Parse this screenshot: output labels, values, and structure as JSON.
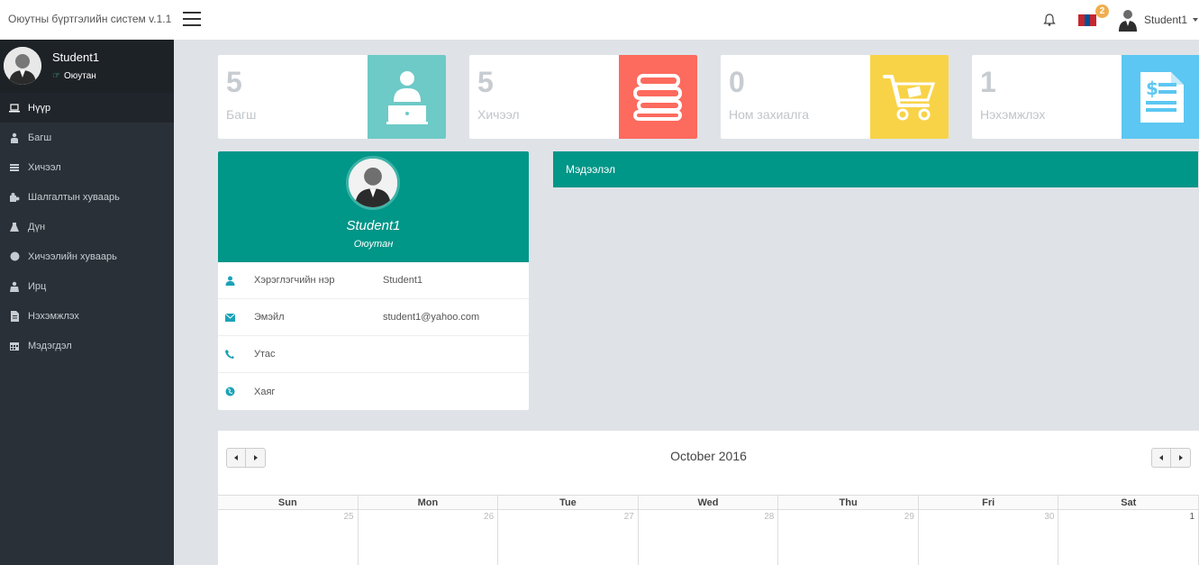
{
  "app": {
    "title": "Оюутны бүртгэлийн систем v.1.1"
  },
  "topbar": {
    "notifications_icon": "bell-icon",
    "language_badge": "2",
    "flag_colors": [
      "#c4272f",
      "#015197",
      "#c4272f"
    ],
    "user_name": "Student1"
  },
  "sidebar": {
    "user": {
      "name": "Student1",
      "role": "Оюутан",
      "status_color": "#4fd1a7"
    },
    "items": [
      {
        "label": "Нүүр",
        "icon": "laptop-icon",
        "active": true
      },
      {
        "label": "Багш",
        "icon": "teacher-icon"
      },
      {
        "label": "Хичээл",
        "icon": "book-icon"
      },
      {
        "label": "Шалгалтын хуваарь",
        "icon": "puzzle-icon"
      },
      {
        "label": "Дүн",
        "icon": "flask-icon"
      },
      {
        "label": "Хичээлийн хуваарь",
        "icon": "circle-icon"
      },
      {
        "label": "Ирц",
        "icon": "attendance-icon"
      },
      {
        "label": "Нэхэмжлэх",
        "icon": "document-icon"
      },
      {
        "label": "Мэдэгдэл",
        "icon": "calendar-icon"
      }
    ]
  },
  "stats": [
    {
      "value": "5",
      "label": "Багш",
      "color": "#6dcac7",
      "icon": "teacher-icon"
    },
    {
      "value": "5",
      "label": "Хичээл",
      "color": "#fd6a5e",
      "icon": "books-icon"
    },
    {
      "value": "0",
      "label": "Ном захиалга",
      "color": "#f8d348",
      "icon": "cart-icon"
    },
    {
      "value": "1",
      "label": "Нэхэмжлэх",
      "color": "#5cc7f2",
      "icon": "invoice-icon"
    }
  ],
  "profile": {
    "name": "Student1",
    "role": "Оюутан",
    "header_color": "#009688",
    "fields": [
      {
        "label": "Хэрэглэгчийн нэр",
        "value": "Student1",
        "icon": "user-icon"
      },
      {
        "label": "Эмэйл",
        "value": "student1@yahoo.com",
        "icon": "envelope-icon"
      },
      {
        "label": "Утас",
        "value": "",
        "icon": "phone-icon"
      },
      {
        "label": "Хаяг",
        "value": "",
        "icon": "globe-icon"
      }
    ]
  },
  "info_panel": {
    "title": "Мэдээлэл"
  },
  "calendar": {
    "title": "October 2016",
    "weekdays": [
      "Sun",
      "Mon",
      "Tue",
      "Wed",
      "Thu",
      "Fri",
      "Sat"
    ],
    "first_row": [
      "25",
      "26",
      "27",
      "28",
      "29",
      "30",
      "1"
    ]
  }
}
